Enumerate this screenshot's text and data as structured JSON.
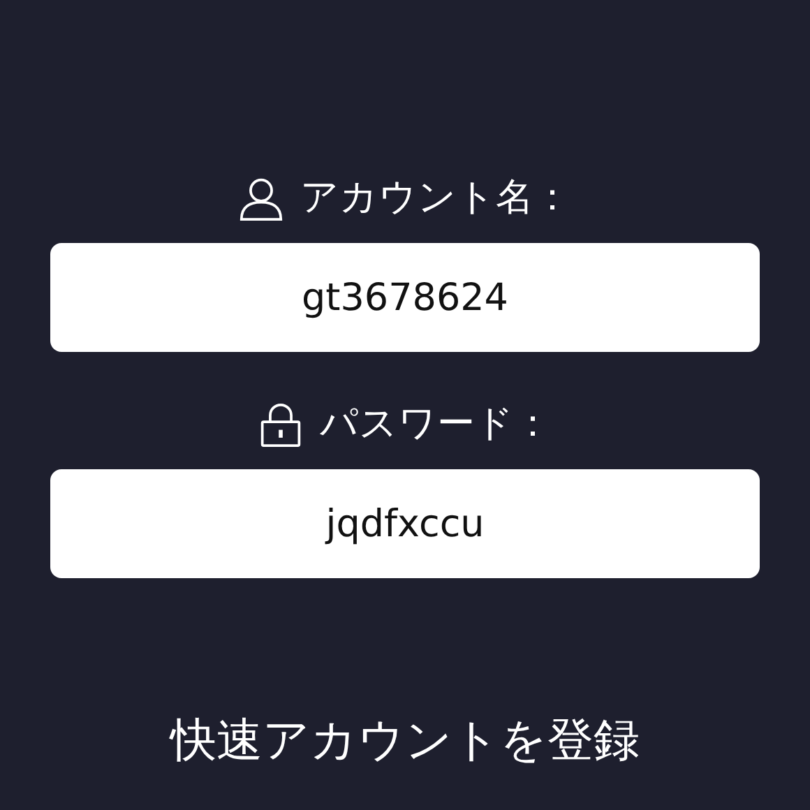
{
  "fields": [
    {
      "kind": "user",
      "label": "アカウント名：",
      "value": "gt3678624"
    },
    {
      "kind": "lock",
      "label": "パスワード：",
      "value": "jqdfxccu"
    }
  ],
  "register_link": "快速アカウントを登録"
}
